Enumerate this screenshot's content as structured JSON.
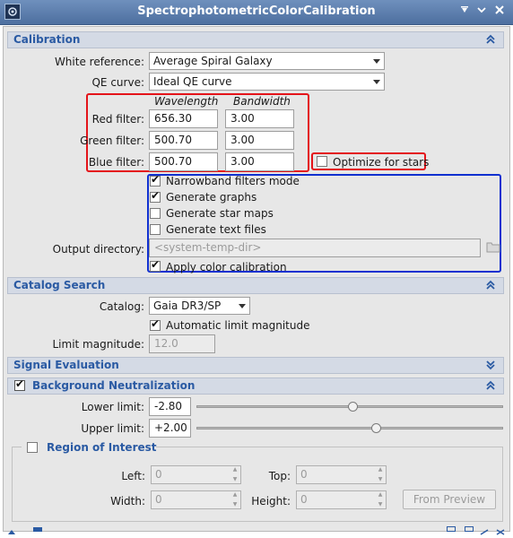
{
  "window": {
    "title": "SpectrophotometricColorCalibration"
  },
  "sections": {
    "calibration": "Calibration",
    "catalog_search": "Catalog Search",
    "signal_evaluation": "Signal Evaluation",
    "background_neutralization": "Background Neutralization"
  },
  "calibration": {
    "white_reference_label": "White reference:",
    "white_reference_value": "Average Spiral Galaxy",
    "qe_curve_label": "QE curve:",
    "qe_curve_value": "Ideal QE curve",
    "col_wavelength": "Wavelength",
    "col_bandwidth": "Bandwidth",
    "filters": [
      {
        "label": "Red filter:",
        "wavelength": "656.30",
        "bandwidth": "3.00"
      },
      {
        "label": "Green filter:",
        "wavelength": "500.70",
        "bandwidth": "3.00"
      },
      {
        "label": "Blue filter:",
        "wavelength": "500.70",
        "bandwidth": "3.00"
      }
    ],
    "optimize_for_stars": "Optimize for stars",
    "narrowband_mode": "Narrowband filters mode",
    "generate_graphs": "Generate graphs",
    "generate_star_maps": "Generate star maps",
    "generate_text_files": "Generate text files",
    "output_directory_label": "Output directory:",
    "output_directory_placeholder": "<system-temp-dir>",
    "apply_color_calibration": "Apply color calibration"
  },
  "catalog": {
    "catalog_label": "Catalog:",
    "catalog_value": "Gaia DR3/SP",
    "automatic_limit_magnitude": "Automatic limit magnitude",
    "limit_magnitude_label": "Limit magnitude:",
    "limit_magnitude_value": "12.0"
  },
  "background": {
    "lower_limit_label": "Lower limit:",
    "lower_limit_value": "-2.80",
    "lower_limit_fraction": 0.51,
    "upper_limit_label": "Upper limit:",
    "upper_limit_value": "+2.00",
    "upper_limit_fraction": 0.59,
    "roi_title": "Region of Interest",
    "left_label": "Left:",
    "left_value": "0",
    "top_label": "Top:",
    "top_value": "0",
    "width_label": "Width:",
    "width_value": "0",
    "height_label": "Height:",
    "height_value": "0",
    "from_preview": "From Preview"
  },
  "colors": {
    "titlebar": "#5b7cab",
    "section_title": "#2a5aa3",
    "annotation_red": "#e4141a",
    "annotation_blue": "#1030d0"
  }
}
